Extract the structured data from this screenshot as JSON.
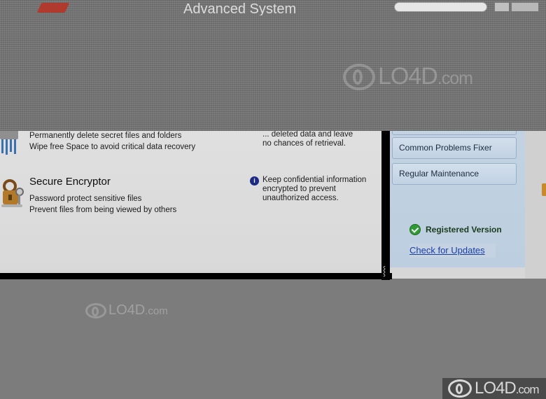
{
  "window": {
    "title": "Advanced System"
  },
  "features": [
    {
      "title": "",
      "lines": [
        "Permanently delete secret files and folders",
        "Wipe free Space to avoid critical data recovery"
      ],
      "description": [
        "... deleted data and leave",
        "no chances of retrieval."
      ]
    },
    {
      "title": "Secure Encryptor",
      "lines": [
        "Password protect sensitive files",
        "Prevent files from being viewed by others"
      ],
      "description": [
        "Keep confidential information",
        "encrypted to prevent",
        "unauthorized access."
      ]
    }
  ],
  "sidebar": {
    "buttons": [
      "",
      "Common Problems Fixer",
      "Regular Maintenance"
    ],
    "status": "Registered Version",
    "update_link": "Check for Updates"
  },
  "watermark": {
    "brand": "LO4D",
    "suffix": ".com"
  },
  "colors": {
    "link": "#1a3ea8",
    "check": "#2f9a36",
    "info": "#1b2a86"
  },
  "icons": {
    "shredder": "shredder-icon",
    "encryptor": "lock-keys-icon",
    "info": "info-icon",
    "check": "check-circle-icon",
    "grip": "resize-grip-icon"
  }
}
